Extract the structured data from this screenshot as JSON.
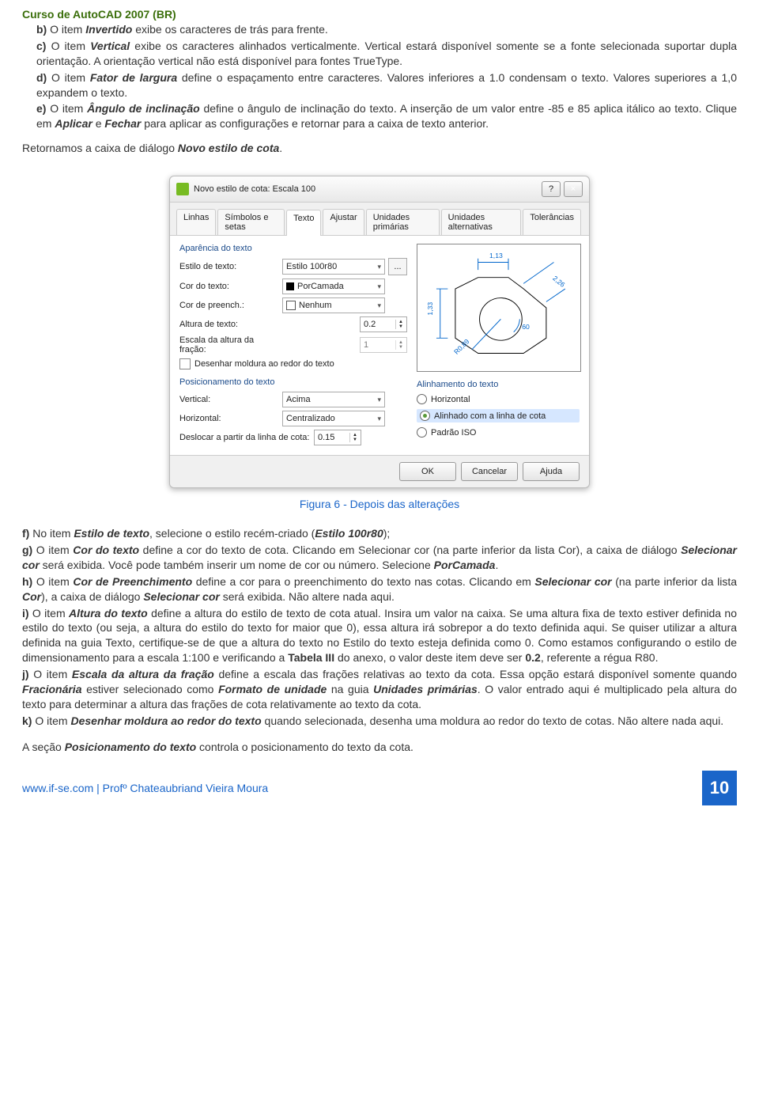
{
  "header": {
    "course": "Curso de AutoCAD 2007 (BR)"
  },
  "body": {
    "b_prefix": "b) ",
    "b_t1": "O item ",
    "b_invertido": "Invertido",
    "b_t2": " exibe os caracteres de trás para frente.",
    "c_prefix": "c) ",
    "c_t1": "O item ",
    "c_vertical": "Vertical",
    "c_t2": " exibe os caracteres alinhados verticalmente. Vertical estará disponível somente se a fonte selecionada suportar dupla orientação. A orientação vertical não está disponível para fontes TrueType.",
    "d_prefix": "d) ",
    "d_t1": "O item ",
    "d_fator": "Fator de largura",
    "d_t2": " define o espaçamento entre caracteres. Valores inferiores a 1.0 condensam o texto. Valores superiores a 1,0 expandem o texto.",
    "e_prefix": "e) ",
    "e_t1": "O item ",
    "e_angulo": "Ângulo de inclinação",
    "e_t2": " define o ângulo de inclinação do texto. A inserção de um valor entre -85 e 85 aplica itálico ao texto. Clique em ",
    "e_aplicar": "Aplicar",
    "e_t3": " e ",
    "e_fechar": "Fechar",
    "e_t4": "  para aplicar as configurações e retornar para a caixa de texto anterior.",
    "ret_t1": "Retornamos a caixa de diálogo ",
    "ret_novo": "Novo estilo de cota",
    "ret_t2": "."
  },
  "dialog": {
    "title": "Novo estilo de cota: Escala 100",
    "help": "?",
    "close": "×",
    "tabs": [
      "Linhas",
      "Símbolos e setas",
      "Texto",
      "Ajustar",
      "Unidades primárias",
      "Unidades alternativas",
      "Tolerâncias"
    ],
    "active_tab_index": 2,
    "section_appearance": "Aparência do texto",
    "row_style_label": "Estilo de texto:",
    "row_style_value": "Estilo 100r80",
    "row_style_ellipsis": "...",
    "row_color_label": "Cor do texto:",
    "row_color_value": "PorCamada",
    "row_fill_label": "Cor de preench.:",
    "row_fill_value": "Nenhum",
    "row_height_label": "Altura de texto:",
    "row_height_value": "0.2",
    "row_fraction_label": "Escala da altura da fração:",
    "row_fraction_value": "1",
    "cb_frame": "Desenhar moldura ao redor do texto",
    "section_placement": "Posicionamento do texto",
    "row_vert_label": "Vertical:",
    "row_vert_value": "Acima",
    "row_horiz_label": "Horizontal:",
    "row_horiz_value": "Centralizado",
    "row_offset_label": "Deslocar a partir da linha de cota:",
    "row_offset_value": "0.15",
    "section_align": "Alinhamento do texto",
    "radio1": "Horizontal",
    "radio2": "Alinhado com a linha de cota",
    "radio3": "Padrão ISO",
    "preview": {
      "top": "1,13",
      "left": "1,33",
      "diag": "2,26",
      "angle": "60",
      "radius": "R0,89"
    },
    "btn_ok": "OK",
    "btn_cancel": "Cancelar",
    "btn_help": "Ajuda"
  },
  "caption": "Figura 6 - Depois das alterações",
  "lower": {
    "f_prefix": "f) ",
    "f_t1": "No item ",
    "f_estilo": "Estilo de texto",
    "f_t2": ", selecione o estilo recém-criado (",
    "f_estilo2": "Estilo 100r80",
    "f_t3": ");",
    "g_prefix": "g) ",
    "g_t1": "O item ",
    "g_cor": "Cor do texto",
    "g_t2": " define a cor do texto de cota. Clicando em Selecionar cor (na parte inferior da lista Cor), a caixa de diálogo ",
    "g_sel": "Selecionar cor",
    "g_t3": " será exibida. Você pode também inserir um nome de cor ou número. Selecione ",
    "g_porcamada": "PorCamada",
    "g_t4": ".",
    "h_prefix": "h) ",
    "h_t1": "O item ",
    "h_corp": "Cor de Preenchimento",
    "h_t2": "  define a cor para o preenchimento do texto nas cotas. Clicando em ",
    "h_sel": "Selecionar cor",
    "h_t3": " (na parte inferior da lista ",
    "h_cor": "Cor",
    "h_t4": "), a caixa de diálogo ",
    "h_sel2": "Selecionar cor",
    "h_t5": " será exibida. Não altere nada aqui.",
    "i_prefix": "i) ",
    "i_t1": "O item ",
    "i_alt": "Altura do texto",
    "i_t2": " define a altura do estilo de texto de cota atual. Insira um valor na caixa. Se uma altura fixa de texto estiver definida no estilo do texto (ou seja, a altura do estilo do texto for maior que 0), essa altura irá sobrepor a do texto definida aqui. Se quiser utilizar a altura definida na guia Texto, certifique-se de que a altura do texto no Estilo do texto esteja definida como 0. Como estamos configurando o estilo de dimensionamento para a escala 1:100 e verificando a ",
    "i_tab": "Tabela III",
    "i_t3": " do anexo, o valor deste item deve ser ",
    "i_val": "0.2",
    "i_t4": ", referente a régua R80.",
    "j_prefix": "j) ",
    "j_t1": "O item ",
    "j_escala": "Escala da altura da fração",
    "j_t2": " define a escala das frações relativas ao texto da cota. Essa opção estará disponível somente quando ",
    "j_frac": "Fracionária",
    "j_t3": " estiver selecionado como ",
    "j_fmt": "Formato de unidade",
    "j_t4": " na guia ",
    "j_unid": "Unidades primárias",
    "j_t5": ". O valor entrado aqui é multiplicado pela altura do texto para determinar a altura das frações de cota relativamente ao texto da cota.",
    "k_prefix": "k) ",
    "k_t1": "O item ",
    "k_des": "Desenhar moldura ao redor do texto",
    "k_t2": " quando selecionada, desenha uma moldura ao redor do texto de cotas. Não altere nada aqui.",
    "sec_t1": "A seção ",
    "sec_pos": "Posicionamento do texto",
    "sec_t2": " controla o posicionamento do texto da cota."
  },
  "footer": {
    "site": "www.if-se.com | Profº Chateaubriand Vieira Moura",
    "page": "10"
  }
}
